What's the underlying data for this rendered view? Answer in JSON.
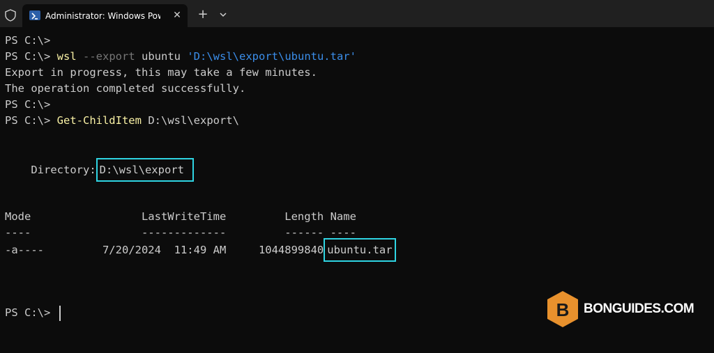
{
  "window": {
    "tab_title": "Administrator: Windows Powe",
    "close_glyph": "✕",
    "new_tab_glyph": "+"
  },
  "terminal": {
    "l1": "PS C:\\>",
    "l2_prompt": "PS C:\\> ",
    "l2_cmd": "wsl",
    "l2_param": "--export",
    "l2_arg": "ubuntu",
    "l2_str": "'D:\\wsl\\export\\ubuntu.tar'",
    "l3": "Export in progress, this may take a few minutes.",
    "l4": "The operation completed successfully.",
    "l5": "PS C:\\>",
    "l6_prompt": "PS C:\\> ",
    "l6_cmd": "Get-ChildItem",
    "l6_arg": "D:\\wsl\\export\\",
    "dir_label": "    Directory:",
    "dir_value": "D:\\wsl\\export",
    "headers": "Mode                 LastWriteTime         Length Name",
    "underline": "----                 -------------         ------ ----",
    "row_prefix": "-a----         7/20/2024  11:49 AM     1044899840",
    "row_name": "ubuntu.tar",
    "final_prompt": "PS C:\\>"
  },
  "brand": {
    "logo_letter": "B",
    "logo_text": "BONGUIDES.COM"
  },
  "colors": {
    "background": "#0c0c0c",
    "titlebar": "#202020",
    "text": "#cccccc",
    "command": "#f9f1a5",
    "parameter": "#767676",
    "string": "#3b8eea",
    "highlight": "#2fd5e3",
    "logo_orange": "#e8912d"
  }
}
